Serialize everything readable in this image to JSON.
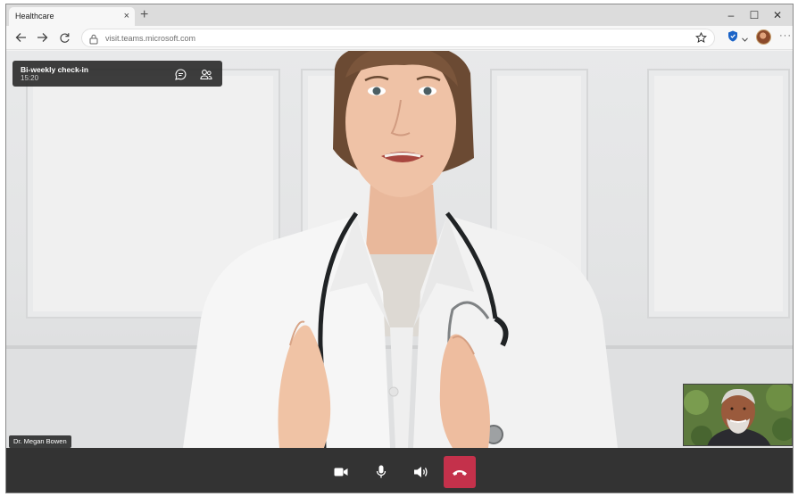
{
  "browser": {
    "tab": {
      "title": "Healthcare",
      "close_label": "×"
    },
    "new_tab_label": "+",
    "window_controls": {
      "minimize": "–",
      "maximize": "☐",
      "close": "✕"
    },
    "url": "visit.teams.microsoft.com",
    "more_label": "···"
  },
  "meeting": {
    "title": "Bi-weekly check-in",
    "time": "15:20",
    "participant_name": "Dr. Megan Bowen"
  },
  "icons": {
    "back": "back-arrow-icon",
    "forward": "forward-arrow-icon",
    "refresh": "refresh-icon",
    "lock": "lock-icon",
    "favorite": "star-icon",
    "chat": "chat-icon",
    "participants": "people-icon",
    "camera": "video-camera-icon",
    "mic": "microphone-icon",
    "speaker": "speaker-icon",
    "hangup": "hang-up-icon"
  },
  "colors": {
    "hangup": "#c4314b",
    "control_bar": "#333333",
    "overlay": "#202020"
  }
}
